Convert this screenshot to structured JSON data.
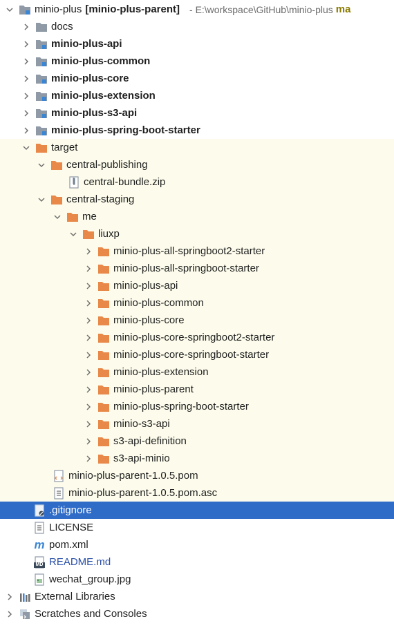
{
  "project": {
    "name": "minio-plus",
    "module_label": "[minio-plus-parent]",
    "path": "- E:\\workspace\\GitHub\\minio-plus",
    "branch": "ma"
  },
  "rows": [
    {
      "label": "docs"
    },
    {
      "label": "minio-plus-api"
    },
    {
      "label": "minio-plus-common"
    },
    {
      "label": "minio-plus-core"
    },
    {
      "label": "minio-plus-extension"
    },
    {
      "label": "minio-plus-s3-api"
    },
    {
      "label": "minio-plus-spring-boot-starter"
    },
    {
      "label": "target"
    },
    {
      "label": "central-publishing"
    },
    {
      "label": "central-bundle.zip"
    },
    {
      "label": "central-staging"
    },
    {
      "label": "me"
    },
    {
      "label": "liuxp"
    },
    {
      "label": "minio-plus-all-springboot2-starter"
    },
    {
      "label": "minio-plus-all-springboot-starter"
    },
    {
      "label": "minio-plus-api"
    },
    {
      "label": "minio-plus-common"
    },
    {
      "label": "minio-plus-core"
    },
    {
      "label": "minio-plus-core-springboot2-starter"
    },
    {
      "label": "minio-plus-core-springboot-starter"
    },
    {
      "label": "minio-plus-extension"
    },
    {
      "label": "minio-plus-parent"
    },
    {
      "label": "minio-plus-spring-boot-starter"
    },
    {
      "label": "minio-s3-api"
    },
    {
      "label": "s3-api-definition"
    },
    {
      "label": "s3-api-minio"
    },
    {
      "label": "minio-plus-parent-1.0.5.pom"
    },
    {
      "label": "minio-plus-parent-1.0.5.pom.asc"
    },
    {
      "label": ".gitignore"
    },
    {
      "label": "LICENSE"
    },
    {
      "label": "pom.xml"
    },
    {
      "label": "README.md"
    },
    {
      "label": "wechat_group.jpg"
    },
    {
      "label": "External Libraries"
    },
    {
      "label": "Scratches and Consoles"
    }
  ],
  "icon_glyphs": {
    "maven": "m",
    "markdown": "MD"
  },
  "colors": {
    "selection": "#2f6cc8",
    "excluded_background": "#fdfcec",
    "folder_orange": "#e8894a",
    "folder_gray": "#8f9aa6",
    "module_blue": "#3a86d4"
  }
}
